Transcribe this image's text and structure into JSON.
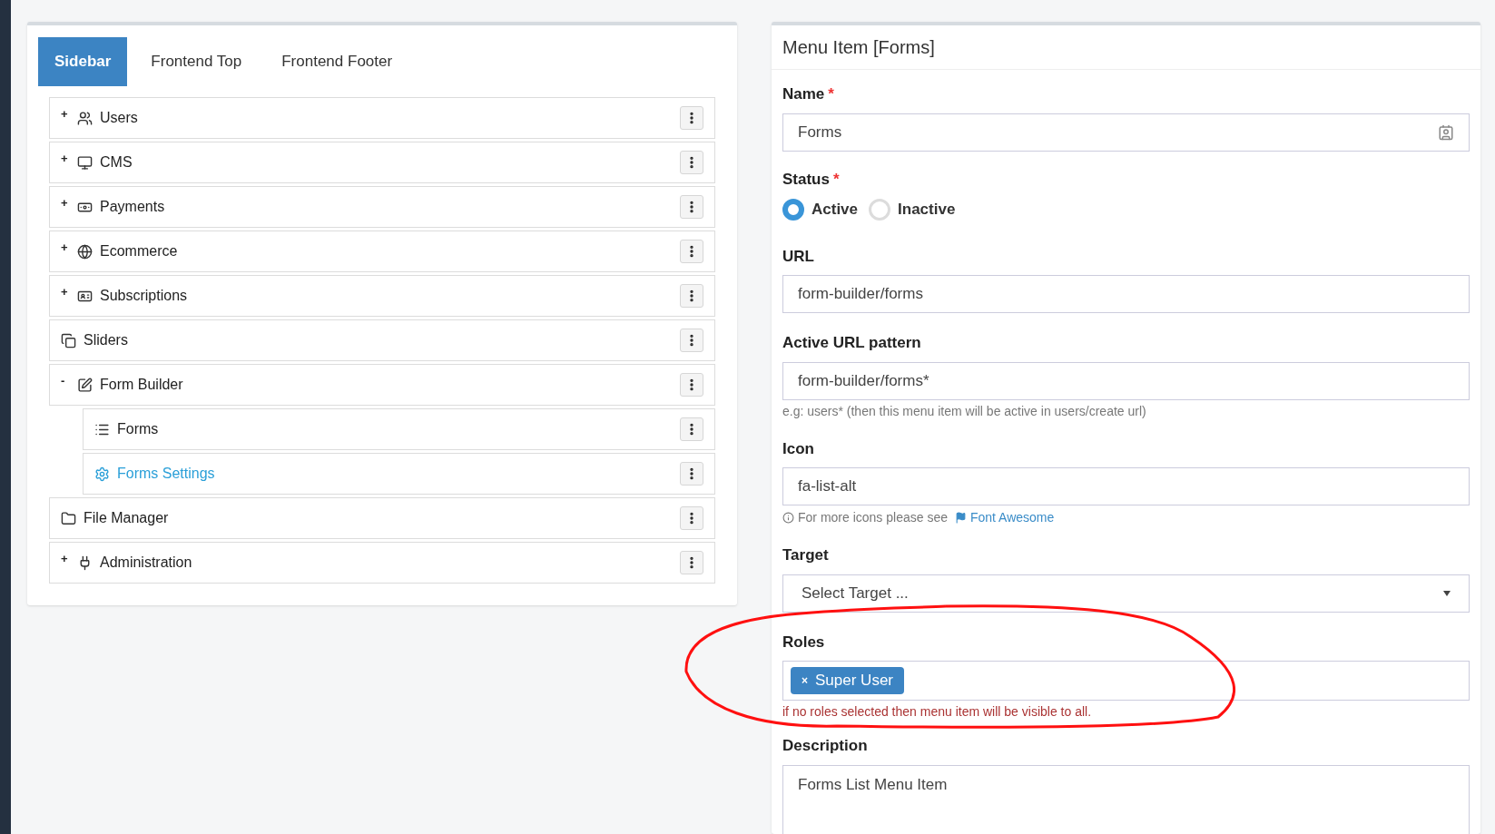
{
  "tabs": [
    {
      "label": "Sidebar",
      "selected": true
    },
    {
      "label": "Frontend Top",
      "selected": false
    },
    {
      "label": "Frontend Footer",
      "selected": false
    }
  ],
  "menu_tree": [
    {
      "toggle": "+",
      "kind": "users",
      "label": "Users",
      "selected": false
    },
    {
      "toggle": "+",
      "kind": "monitor",
      "label": "CMS",
      "selected": false
    },
    {
      "toggle": "+",
      "kind": "money",
      "label": "Payments",
      "selected": false
    },
    {
      "toggle": "+",
      "kind": "globe",
      "label": "Ecommerce",
      "selected": false
    },
    {
      "toggle": "+",
      "kind": "idcard",
      "label": "Subscriptions",
      "selected": false
    },
    {
      "kind": "copy",
      "label": "Sliders",
      "selected": false
    },
    {
      "toggle": "-",
      "kind": "edit",
      "label": "Form Builder",
      "selected": false,
      "children": [
        {
          "kind": "list",
          "label": "Forms",
          "selected": false
        },
        {
          "kind": "gear",
          "label": "Forms Settings",
          "selected": true
        }
      ]
    },
    {
      "kind": "folder",
      "label": "File Manager",
      "selected": false
    },
    {
      "toggle": "+",
      "kind": "plug",
      "label": "Administration",
      "selected": false
    }
  ],
  "form": {
    "title": "Menu Item [Forms]",
    "name": {
      "label": "Name",
      "required_mark": "*",
      "value": "Forms"
    },
    "status": {
      "label": "Status",
      "required_mark": "*",
      "options": [
        {
          "label": "Active",
          "selected": true
        },
        {
          "label": "Inactive",
          "selected": false
        }
      ]
    },
    "url": {
      "label": "URL",
      "value": "form-builder/forms"
    },
    "active_url_pattern": {
      "label": "Active URL pattern",
      "value": "form-builder/forms*",
      "help": "e.g: users* (then this menu item will be active in users/create url)"
    },
    "icon": {
      "label": "Icon",
      "value": "fa-list-alt",
      "help": "For more icons please see",
      "link": "Font Awesome"
    },
    "target": {
      "label": "Target",
      "placeholder": "Select Target ..."
    },
    "roles": {
      "label": "Roles",
      "remove": "×",
      "tags": [
        "Super User"
      ],
      "help": "if no roles selected then menu item will be visible to all."
    },
    "description": {
      "label": "Description",
      "value": "Forms List Menu Item"
    }
  }
}
